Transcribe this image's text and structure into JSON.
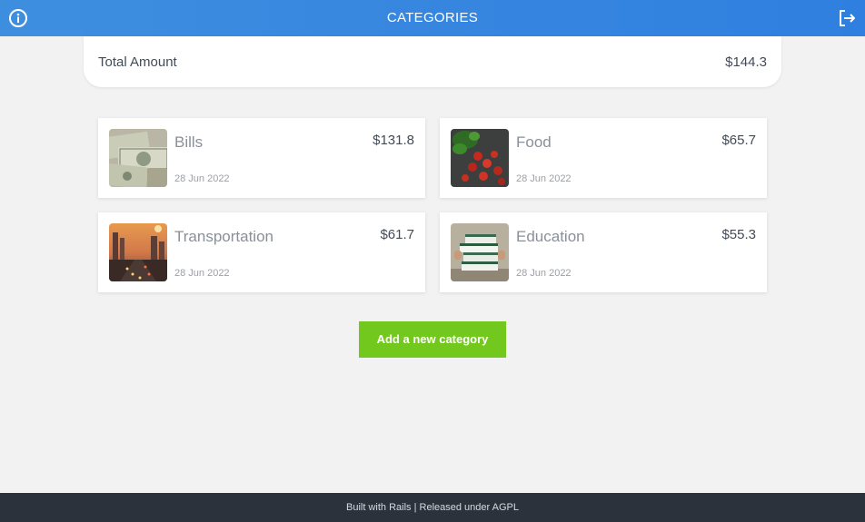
{
  "header": {
    "title": "CATEGORIES",
    "left_icon": "info-circle-icon",
    "right_icon": "logout-icon"
  },
  "total": {
    "label": "Total Amount",
    "value": "$144.3"
  },
  "categories": [
    {
      "name": "Bills",
      "amount": "$131.8",
      "date": "28 Jun 2022",
      "image": "dollar-bills-image"
    },
    {
      "name": "Food",
      "amount": "$65.7",
      "date": "28 Jun 2022",
      "image": "vegetables-image"
    },
    {
      "name": "Transportation",
      "amount": "$61.7",
      "date": "28 Jun 2022",
      "image": "highway-traffic-image"
    },
    {
      "name": "Education",
      "amount": "$55.3",
      "date": "28 Jun 2022",
      "image": "stack-of-books-image"
    }
  ],
  "add_button": {
    "label": "Add a new category"
  },
  "footer": {
    "text": "Built with Rails | Released under AGPL"
  },
  "colors": {
    "header_blue": "#2f7fe0",
    "button_green": "#73c81e",
    "footer_dark": "#2b323b",
    "background": "#f2f2f2"
  }
}
